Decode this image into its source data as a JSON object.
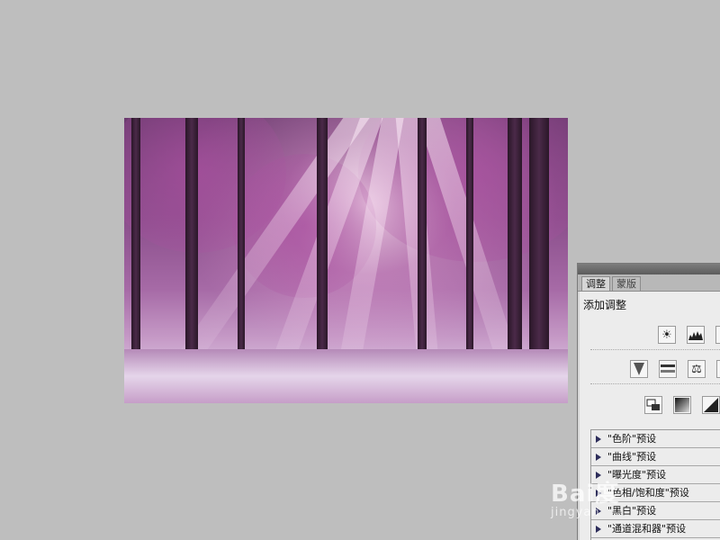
{
  "canvas": {
    "background": "#bebebe",
    "image": {
      "subject": "forest-light-rays",
      "tint": "#a66aa6"
    }
  },
  "adjustments_panel": {
    "tabs": [
      {
        "label": "调整",
        "active": true
      },
      {
        "label": "蒙版",
        "active": false
      }
    ],
    "add_adjustment_label": "添加调整",
    "icon_rows": [
      [
        "brightness-contrast-icon",
        "levels-icon",
        "curves-icon"
      ],
      [
        "vibrance-icon",
        "hue-saturation-icon",
        "color-balance-icon",
        "black-white-icon"
      ],
      [
        "photo-filter-icon",
        "gradient-map-icon",
        "selective-color-icon"
      ]
    ],
    "presets": [
      {
        "label": "\"色阶\"预设"
      },
      {
        "label": "\"曲线\"预设"
      },
      {
        "label": "\"曝光度\"预设"
      },
      {
        "label": "\"色相/饱和度\"预设"
      },
      {
        "label": "\"黑白\"预设"
      },
      {
        "label": "\"通道混和器\"预设"
      }
    ]
  },
  "watermark": {
    "text": "Bai度",
    "sub": "jingyan"
  }
}
